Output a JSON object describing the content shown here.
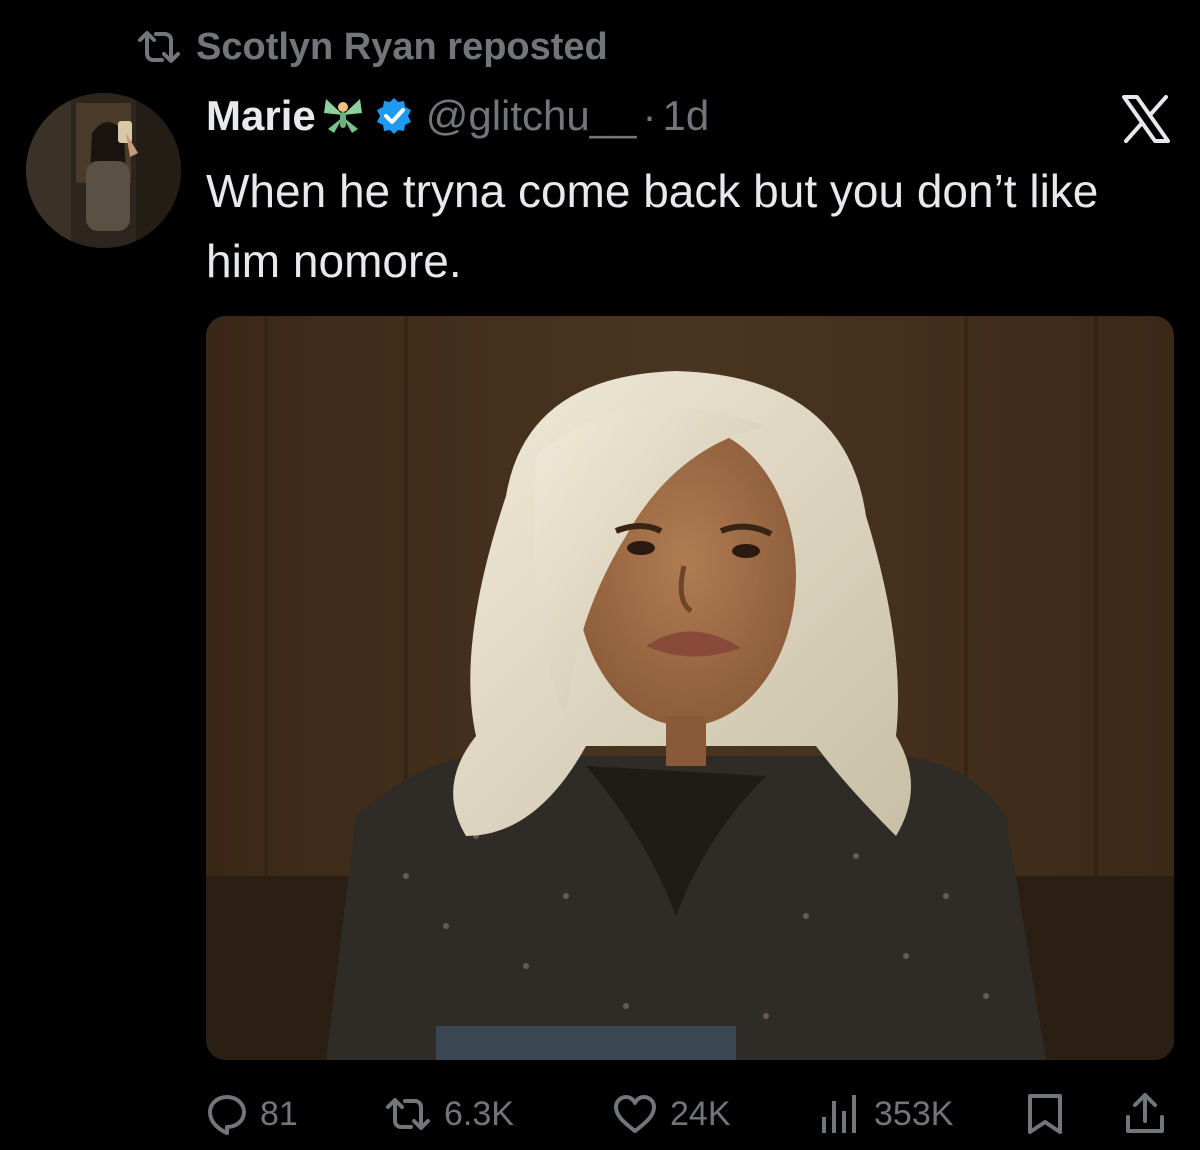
{
  "repost": {
    "text": "Scotlyn Ryan reposted"
  },
  "post": {
    "display_name": "Marie",
    "name_emoji": "fairy-icon",
    "verified": true,
    "handle": "@glitchu__",
    "separator": "·",
    "time": "1d",
    "text": "When he tryna come back but you don’t like him nomore."
  },
  "metrics": {
    "replies": "81",
    "reposts": "6.3K",
    "likes": "24K",
    "views": "353K"
  },
  "icons": {
    "repost": "repost-icon",
    "verified": "verified-badge-icon",
    "platform": "x-logo-icon",
    "reply": "reply-icon",
    "like": "heart-icon",
    "views": "views-icon",
    "bookmark": "bookmark-icon",
    "share": "share-icon"
  },
  "colors": {
    "background": "#000000",
    "text_primary": "#e7e9ea",
    "text_secondary": "#71767b",
    "verified_blue": "#1d9bf0"
  }
}
